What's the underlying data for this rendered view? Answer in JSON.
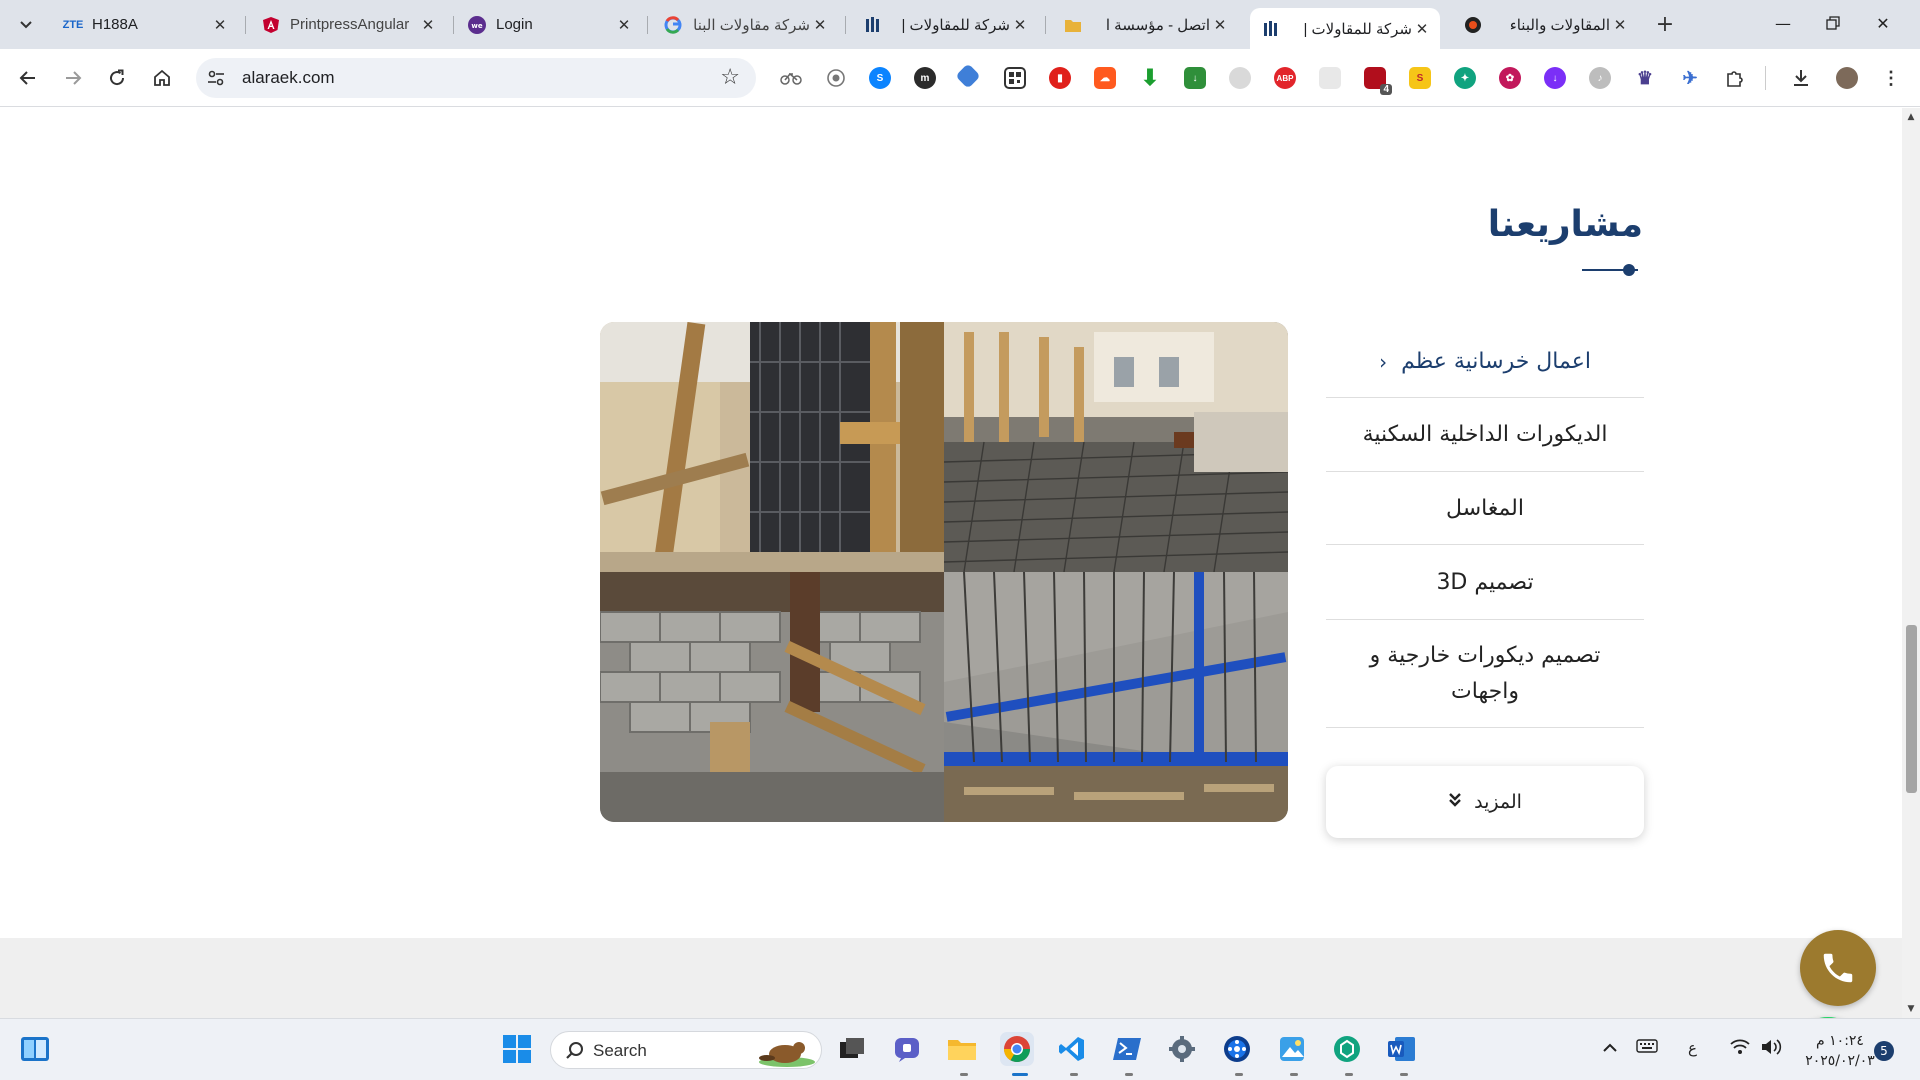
{
  "browser": {
    "tabs": [
      {
        "label": "H188A",
        "favicon": "zte-icon",
        "favicon_text": "ZTE"
      },
      {
        "label": "PrintpressAngular",
        "favicon": "angular-icon"
      },
      {
        "label": "Login",
        "favicon": "web-icon"
      },
      {
        "label": "شركة مقاولات البناء",
        "favicon": "google-icon"
      },
      {
        "label": "شركة للمقاولات |",
        "favicon": "site-logo-icon"
      },
      {
        "label": "اتصل - مؤسسة ا",
        "favicon": "folder-icon"
      },
      {
        "label": "شركة للمقاولات |",
        "favicon": "site-logo-icon",
        "active": true
      },
      {
        "label": "المقاولات والبناء",
        "favicon": "circle-icon"
      }
    ],
    "url": "alaraek.com",
    "extension_badge": "4"
  },
  "page": {
    "section_title": "مشاريعنا",
    "categories": [
      {
        "label": "اعمال خرسانية عظم",
        "active": true
      },
      {
        "label": "الديكورات الداخلية السكنية"
      },
      {
        "label": "المغاسل"
      },
      {
        "label": "تصميم 3D"
      },
      {
        "label": "تصميم ديكورات خارجية و واجهات"
      }
    ],
    "more_button": "المزيد",
    "colors": {
      "brand": "#1c3e6e",
      "call": "#9c7a2e",
      "whatsapp": "#25d366"
    }
  },
  "taskbar": {
    "search_label": "Search",
    "lang": "ع",
    "time": "١٠:٢٤ م",
    "date": "٢٠٢٥/٠٢/٠٣",
    "notifications": "5"
  }
}
